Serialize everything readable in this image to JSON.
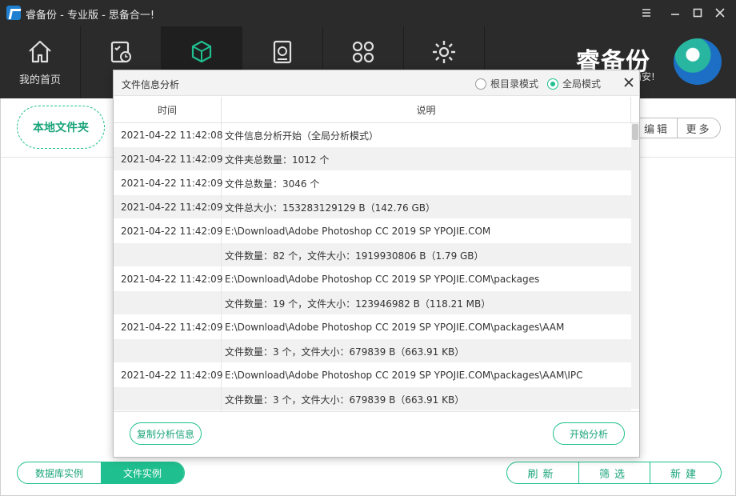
{
  "window": {
    "title": "睿备份 - 专业版 - 思备合一!"
  },
  "toolbar": {
    "items": [
      {
        "label": "我的首页",
        "icon": "home-icon"
      },
      {
        "label": "",
        "icon": "task-schedule-icon"
      },
      {
        "label": "",
        "icon": "cube-icon"
      },
      {
        "label": "",
        "icon": "disk-restore-icon"
      },
      {
        "label": "",
        "icon": "apps-grid-icon"
      },
      {
        "label": "",
        "icon": "gear-icon"
      }
    ],
    "active_index": 2
  },
  "brand": {
    "name": "睿备份",
    "slogan": "而安!"
  },
  "main": {
    "folder_tab": "本地文件夹",
    "top_actions": [
      "编辑",
      "更多"
    ],
    "bottom_tabs": [
      "数据库实例",
      "文件实例"
    ],
    "bottom_tab_selected": "文件实例",
    "bottom_actions": [
      "刷新",
      "筛选",
      "新建"
    ]
  },
  "dialog": {
    "title": "文件信息分析",
    "modes": [
      {
        "label": "根目录模式",
        "checked": false
      },
      {
        "label": "全局模式",
        "checked": true
      }
    ],
    "columns": {
      "time": "时间",
      "desc": "说明"
    },
    "rows": [
      {
        "time": "2021-04-22 11:42:08",
        "desc": "文件信息分析开始（全局分析模式）"
      },
      {
        "time": "2021-04-22 11:42:09",
        "desc": "文件夹总数量：1012 个"
      },
      {
        "time": "2021-04-22 11:42:09",
        "desc": "文件总数量：3046 个"
      },
      {
        "time": "2021-04-22 11:42:09",
        "desc": "文件总大小：153283129129 B（142.76 GB）"
      },
      {
        "time": "2021-04-22 11:42:09",
        "desc": "E:\\Download\\Adobe Photoshop CC 2019 SP YPOJIE.COM"
      },
      {
        "time": "",
        "desc": "文件数量：82 个，文件大小：1919930806 B（1.79 GB）"
      },
      {
        "time": "2021-04-22 11:42:09",
        "desc": "E:\\Download\\Adobe Photoshop CC 2019 SP YPOJIE.COM\\packages"
      },
      {
        "time": "",
        "desc": "文件数量：19 个，文件大小：123946982 B（118.21 MB）"
      },
      {
        "time": "2021-04-22 11:42:09",
        "desc": "E:\\Download\\Adobe Photoshop CC 2019 SP YPOJIE.COM\\packages\\AAM"
      },
      {
        "time": "",
        "desc": "文件数量：3 个，文件大小：679839 B（663.91 KB）"
      },
      {
        "time": "2021-04-22 11:42:09",
        "desc": "E:\\Download\\Adobe Photoshop CC 2019 SP YPOJIE.COM\\packages\\AAM\\IPC"
      },
      {
        "time": "",
        "desc": "文件数量：3 个，文件大小：679839 B（663.91 KB）"
      }
    ],
    "copy_button": "复制分析信息",
    "start_button": "开始分析"
  },
  "colors": {
    "accent": "#1fbf8f",
    "toolbar_bg": "#2b2b2b",
    "toolbar_active": "#1f1f1f"
  }
}
